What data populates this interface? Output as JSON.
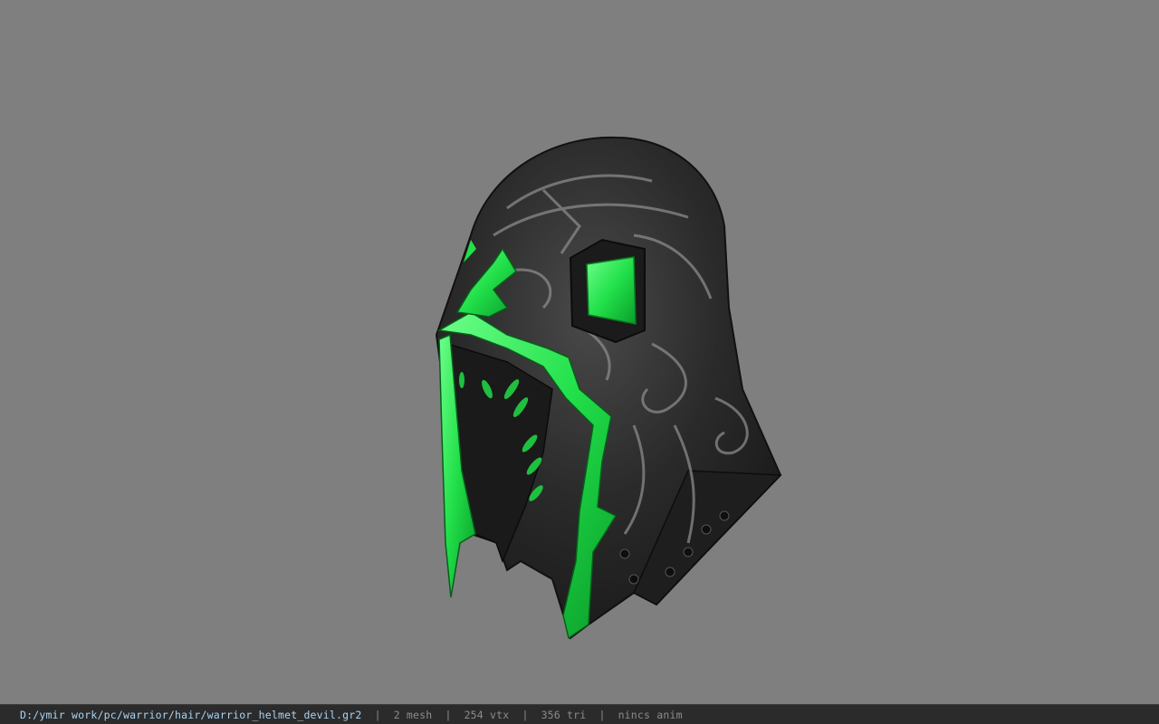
{
  "viewport": {
    "background_color": "#7f7f7f",
    "model_name": "warrior_helmet_devil",
    "accent_color": "#22e04a",
    "metal_color": "#2a2a2a"
  },
  "statusbar": {
    "file_path": "D:/ymir work/pc/warrior/hair/warrior_helmet_devil.gr2",
    "separator": "|",
    "mesh_count": "2 mesh",
    "vertex_count": "254 vtx",
    "triangle_count": "356 tri",
    "anim_status": "nincs anim",
    "path_color": "#a9d4f5",
    "text_color": "#8c8c8c"
  }
}
